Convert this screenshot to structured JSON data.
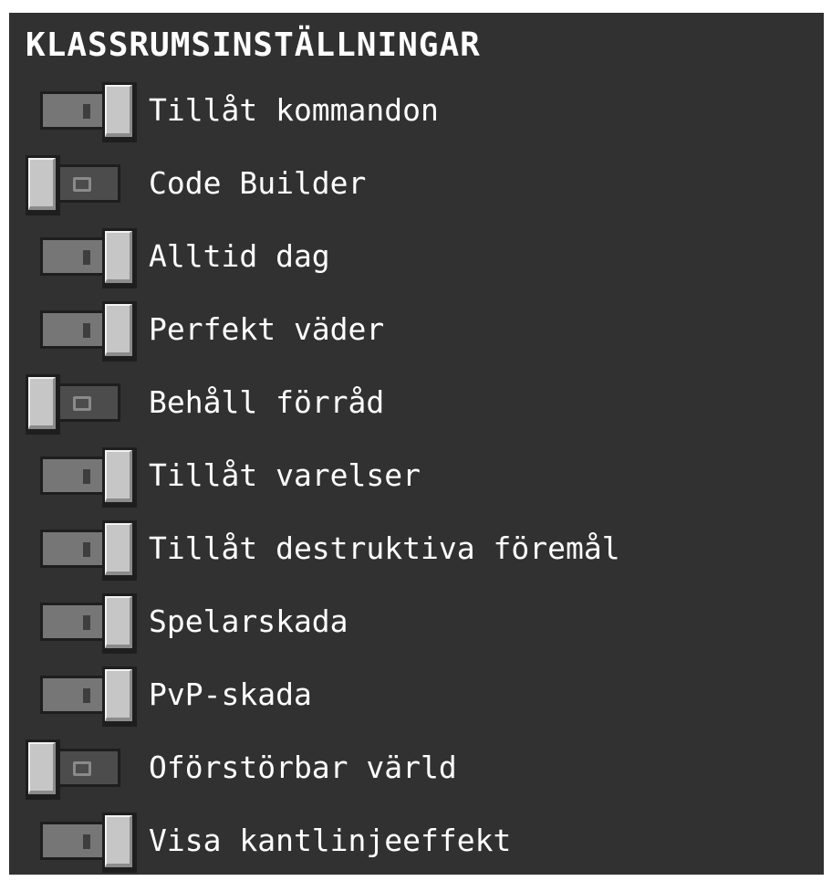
{
  "panel": {
    "title": "KLASSRUMSINSTÄLLNINGAR"
  },
  "settings": [
    {
      "label": "Tillåt kommandon",
      "enabled": true
    },
    {
      "label": "Code Builder",
      "enabled": false
    },
    {
      "label": "Alltid dag",
      "enabled": true
    },
    {
      "label": "Perfekt väder",
      "enabled": true
    },
    {
      "label": "Behåll förråd",
      "enabled": false
    },
    {
      "label": "Tillåt varelser",
      "enabled": true
    },
    {
      "label": "Tillåt destruktiva föremål",
      "enabled": true
    },
    {
      "label": "Spelarskada",
      "enabled": true
    },
    {
      "label": "PvP-skada",
      "enabled": true
    },
    {
      "label": "Oförstörbar värld",
      "enabled": false
    },
    {
      "label": "Visa kantlinjeeffekt",
      "enabled": true
    }
  ],
  "colors": {
    "panel_background": "#313131",
    "text": "#ffffff",
    "knob": "#c6c6c6",
    "track_on": "#767676",
    "track_off": "#4c4c4c"
  }
}
